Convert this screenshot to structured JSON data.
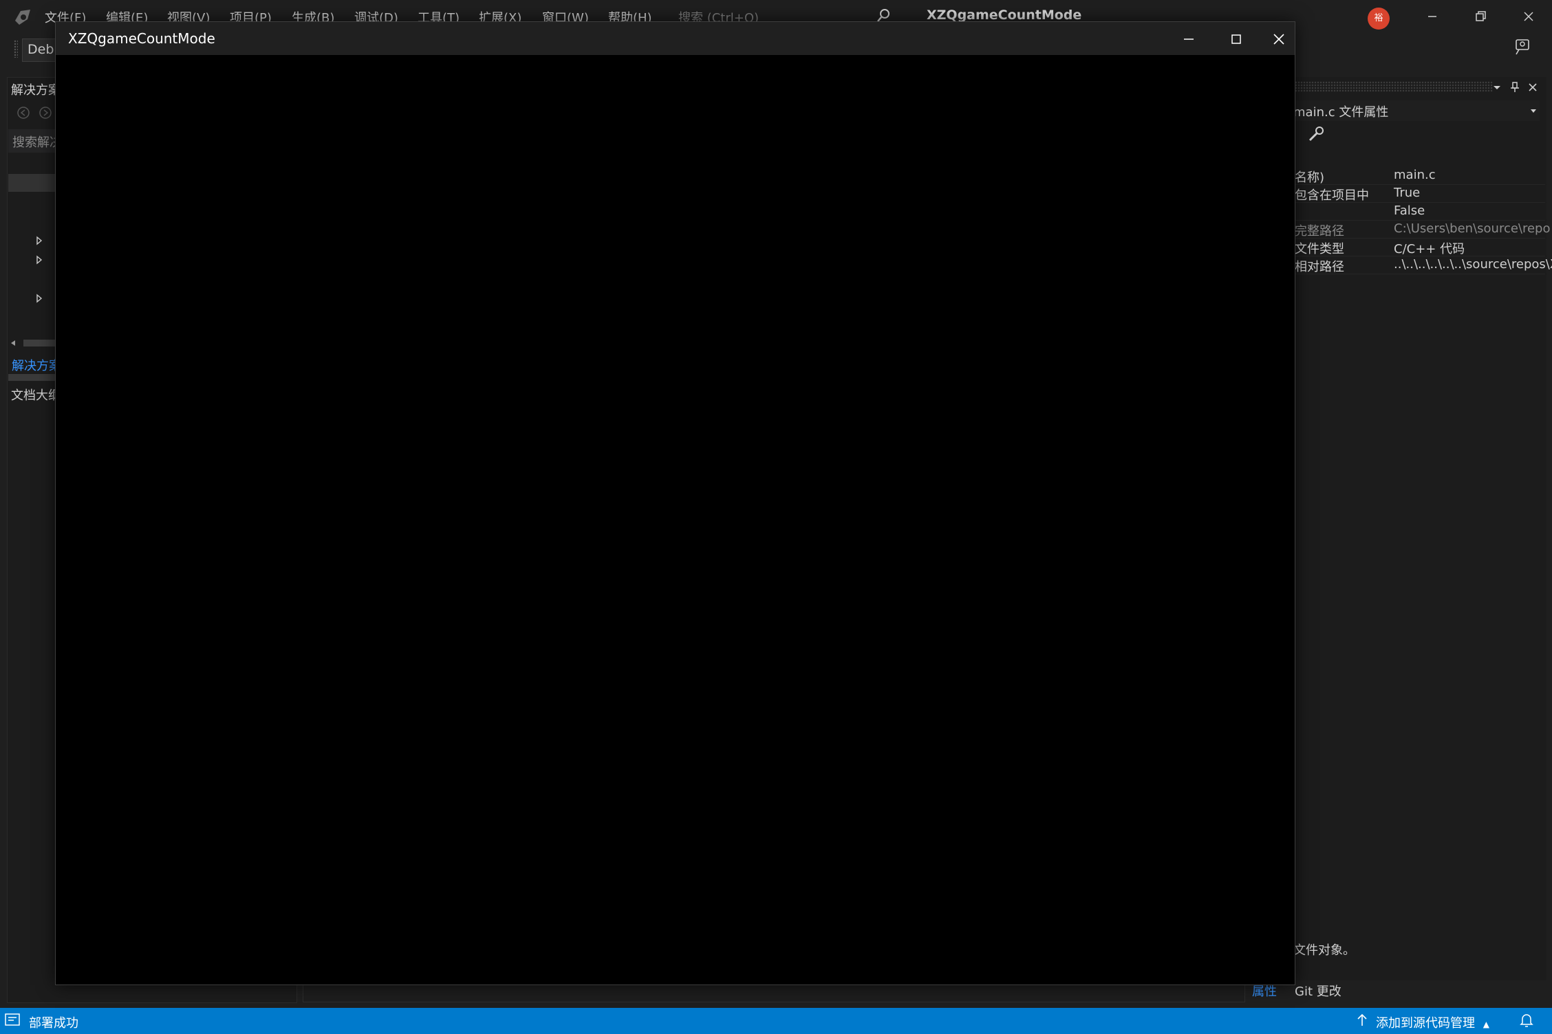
{
  "menubar": {
    "items": [
      "文件(F)",
      "编辑(E)",
      "视图(V)",
      "项目(P)",
      "生成(B)",
      "调试(D)",
      "工具(T)",
      "扩展(X)",
      "窗口(W)",
      "帮助(H)"
    ],
    "search_placeholder": "搜索 (Ctrl+Q)",
    "app_title": "XZQgameCountMode",
    "avatar_text": "裕"
  },
  "toolbar": {
    "config": "Debu"
  },
  "left_panel": {
    "title": "解决方案",
    "search_placeholder": "搜索解决",
    "tabs": [
      "解决方案",
      "文档大纲"
    ]
  },
  "properties": {
    "object": "main.c 文件属性",
    "rows": [
      {
        "name": "名称)",
        "value": "main.c",
        "disabled": false
      },
      {
        "name": "包含在项目中",
        "value": "True",
        "disabled": false
      },
      {
        "name": "",
        "value": "False",
        "disabled": false
      },
      {
        "name": "完整路径",
        "value": "C:\\Users\\ben\\source\\repo",
        "disabled": true
      },
      {
        "name": "文件类型",
        "value": "C/C++ 代码",
        "disabled": false
      },
      {
        "name": "相对路径",
        "value": "..\\..\\..\\..\\..\\..\\source\\repos\\X",
        "disabled": false
      }
    ],
    "description": "文件对象。",
    "tabs": [
      "属性",
      "Git 更改"
    ]
  },
  "console": {
    "title": "XZQgameCountMode"
  },
  "statusbar": {
    "text": "部署成功",
    "source_control": "添加到源代码管理"
  },
  "colors": {
    "accent": "#007acc",
    "link": "#3794ff",
    "background": "#1f1f1f",
    "console": "#000000"
  }
}
